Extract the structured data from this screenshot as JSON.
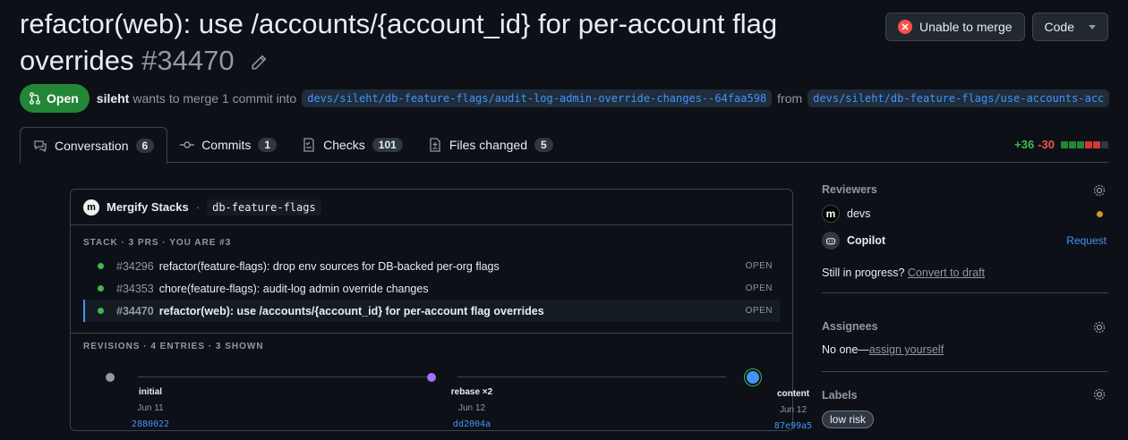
{
  "pr": {
    "title": "refactor(web): use /accounts/{account_id} for per-account flag overrides",
    "number": "#34470",
    "state": "Open",
    "author": "sileht",
    "merge_text": "wants to merge 1 commit into",
    "base_branch": "devs/sileht/db-feature-flags/audit-log-admin-override-changes--64faa598",
    "from_text": "from",
    "head_branch": "devs/sileht/db-feature-flags/use-accounts-acc"
  },
  "header_actions": {
    "unable_label": "Unable to merge",
    "code_label": "Code"
  },
  "tabs": [
    {
      "label": "Conversation",
      "count": "6"
    },
    {
      "label": "Commits",
      "count": "1"
    },
    {
      "label": "Checks",
      "count": "101"
    },
    {
      "label": "Files changed",
      "count": "5"
    }
  ],
  "diffstat": {
    "additions": "+36",
    "deletions": "-30"
  },
  "mergify": {
    "name": "Mergify Stacks",
    "separator": "·",
    "stack_name": "db-feature-flags",
    "stack_label": "STACK · 3 PRS · YOU ARE #3",
    "stack_prs": [
      {
        "number": "#34296",
        "title": "refactor(feature-flags): drop env sources for DB-backed per-org flags",
        "status": "OPEN"
      },
      {
        "number": "#34353",
        "title": "chore(feature-flags): audit-log admin override changes",
        "status": "OPEN"
      },
      {
        "number": "#34470",
        "title": "refactor(web): use /accounts/{account_id} for per-account flag overrides",
        "status": "OPEN"
      }
    ],
    "revisions_label": "REVISIONS · 4 ENTRIES · 3 SHOWN",
    "revisions": [
      {
        "label": "initial",
        "date": "Jun 11",
        "sha": "2880022"
      },
      {
        "label": "rebase ×2",
        "date": "Jun 12",
        "sha": "dd2004a"
      },
      {
        "label": "content",
        "date": "Jun 12",
        "sha": "87e99a5"
      }
    ]
  },
  "sidebar": {
    "reviewers": {
      "heading": "Reviewers",
      "items": [
        {
          "name": "devs"
        },
        {
          "name": "Copilot",
          "action": "Request"
        }
      ],
      "progress_text": "Still in progress?",
      "draft_link": "Convert to draft"
    },
    "assignees": {
      "heading": "Assignees",
      "none_text": "No one—",
      "assign_link": "assign yourself"
    },
    "labels": {
      "heading": "Labels",
      "items": [
        "low risk"
      ]
    }
  },
  "colors": {
    "open_green": "#238636",
    "accent_blue": "#4493f8",
    "danger_red": "#f85149",
    "pending_amber": "#d29922"
  }
}
